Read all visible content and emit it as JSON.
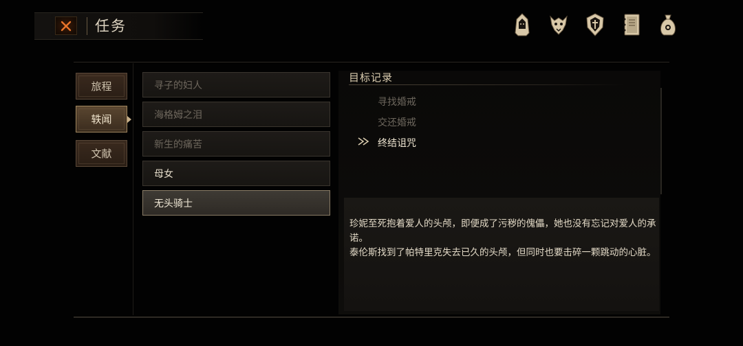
{
  "header": {
    "title": "任务",
    "close_icon": "close-x-icon",
    "icons": [
      {
        "name": "hooded-figure-icon"
      },
      {
        "name": "beast-head-icon"
      },
      {
        "name": "crest-shield-icon"
      },
      {
        "name": "journal-book-icon"
      },
      {
        "name": "coin-pouch-icon"
      }
    ]
  },
  "tabs": [
    {
      "label": "旅程",
      "active": false
    },
    {
      "label": "轶闻",
      "active": true
    },
    {
      "label": "文献",
      "active": false
    }
  ],
  "quests": [
    {
      "label": "寻子的妇人",
      "state": "done"
    },
    {
      "label": "海格姆之泪",
      "state": "done"
    },
    {
      "label": "新生的痛苦",
      "state": "done"
    },
    {
      "label": "母女",
      "state": "normal"
    },
    {
      "label": "无头骑士",
      "state": "selected"
    }
  ],
  "objectives": {
    "heading": "目标记录",
    "items": [
      {
        "label": "寻找婚戒",
        "state": "done"
      },
      {
        "label": "交还婚戒",
        "state": "done"
      },
      {
        "label": "终结诅咒",
        "state": "current"
      }
    ]
  },
  "description": {
    "paragraph1": "珍妮至死抱着爱人的头颅，即便成了污秽的傀儡，她也没有忘记对爱人的承诺。",
    "paragraph2": "泰伦斯找到了帕特里克失去已久的头颅，但同时也要击碎一颗跳动的心脏。"
  },
  "colors": {
    "accent_orange": "#e8742a",
    "icon_gold": "#d8c8a8",
    "active_tab_border": "#a0865e"
  }
}
